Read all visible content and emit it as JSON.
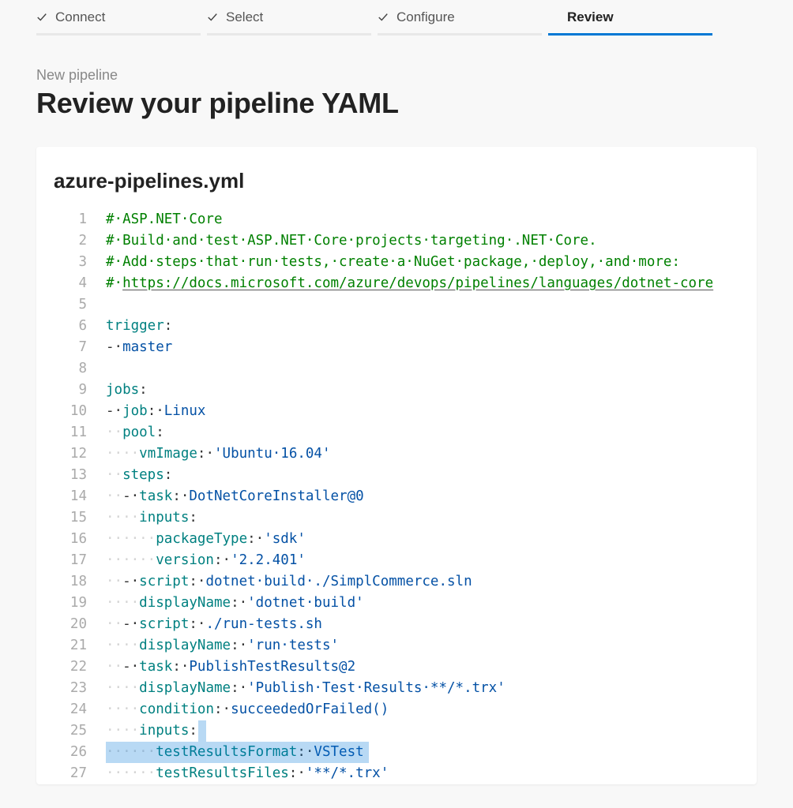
{
  "wizard": {
    "steps": [
      {
        "label": "Connect",
        "done": true,
        "active": false
      },
      {
        "label": "Select",
        "done": true,
        "active": false
      },
      {
        "label": "Configure",
        "done": true,
        "active": false
      },
      {
        "label": "Review",
        "done": false,
        "active": true
      }
    ]
  },
  "breadcrumb": "New pipeline",
  "title": "Review your pipeline YAML",
  "filename": "azure-pipelines.yml",
  "code": {
    "lines": [
      {
        "n": 1,
        "tokens": [
          [
            "comment",
            "# ASP.NET Core"
          ]
        ]
      },
      {
        "n": 2,
        "tokens": [
          [
            "comment",
            "# Build and test ASP.NET Core projects targeting .NET Core."
          ]
        ]
      },
      {
        "n": 3,
        "tokens": [
          [
            "comment",
            "# Add steps that run tests, create a NuGet package, deploy, and more:"
          ]
        ]
      },
      {
        "n": 4,
        "tokens": [
          [
            "comment",
            "# "
          ],
          [
            "link",
            "https://docs.microsoft.com/azure/devops/pipelines/languages/dotnet-core"
          ]
        ]
      },
      {
        "n": 5,
        "tokens": []
      },
      {
        "n": 6,
        "tokens": [
          [
            "key",
            "trigger"
          ],
          [
            "punct",
            ":"
          ]
        ]
      },
      {
        "n": 7,
        "tokens": [
          [
            "punct",
            "- "
          ],
          [
            "val",
            "master"
          ]
        ]
      },
      {
        "n": 8,
        "tokens": []
      },
      {
        "n": 9,
        "tokens": [
          [
            "key",
            "jobs"
          ],
          [
            "punct",
            ":"
          ]
        ]
      },
      {
        "n": 10,
        "tokens": [
          [
            "punct",
            "- "
          ],
          [
            "key",
            "job"
          ],
          [
            "punct",
            ": "
          ],
          [
            "val",
            "Linux"
          ]
        ]
      },
      {
        "n": 11,
        "tokens": [
          [
            "ws",
            "  "
          ],
          [
            "key",
            "pool"
          ],
          [
            "punct",
            ":"
          ]
        ]
      },
      {
        "n": 12,
        "tokens": [
          [
            "ws",
            "    "
          ],
          [
            "key",
            "vmImage"
          ],
          [
            "punct",
            ": "
          ],
          [
            "str",
            "'Ubuntu 16.04'"
          ]
        ]
      },
      {
        "n": 13,
        "tokens": [
          [
            "ws",
            "  "
          ],
          [
            "key",
            "steps"
          ],
          [
            "punct",
            ":"
          ]
        ]
      },
      {
        "n": 14,
        "tokens": [
          [
            "ws",
            "  "
          ],
          [
            "punct",
            "- "
          ],
          [
            "key",
            "task"
          ],
          [
            "punct",
            ": "
          ],
          [
            "val",
            "DotNetCoreInstaller@0"
          ]
        ]
      },
      {
        "n": 15,
        "tokens": [
          [
            "ws",
            "    "
          ],
          [
            "key",
            "inputs"
          ],
          [
            "punct",
            ":"
          ]
        ]
      },
      {
        "n": 16,
        "tokens": [
          [
            "ws",
            "      "
          ],
          [
            "key",
            "packageType"
          ],
          [
            "punct",
            ": "
          ],
          [
            "str",
            "'sdk'"
          ]
        ]
      },
      {
        "n": 17,
        "tokens": [
          [
            "ws",
            "      "
          ],
          [
            "key",
            "version"
          ],
          [
            "punct",
            ": "
          ],
          [
            "str",
            "'2.2.401'"
          ]
        ]
      },
      {
        "n": 18,
        "tokens": [
          [
            "ws",
            "  "
          ],
          [
            "punct",
            "- "
          ],
          [
            "key",
            "script"
          ],
          [
            "punct",
            ": "
          ],
          [
            "val",
            "dotnet build ./SimplCommerce.sln"
          ]
        ]
      },
      {
        "n": 19,
        "tokens": [
          [
            "ws",
            "    "
          ],
          [
            "key",
            "displayName"
          ],
          [
            "punct",
            ": "
          ],
          [
            "str",
            "'dotnet build'"
          ]
        ]
      },
      {
        "n": 20,
        "tokens": [
          [
            "ws",
            "  "
          ],
          [
            "punct",
            "- "
          ],
          [
            "key",
            "script"
          ],
          [
            "punct",
            ": "
          ],
          [
            "val",
            "./run-tests.sh"
          ]
        ]
      },
      {
        "n": 21,
        "tokens": [
          [
            "ws",
            "    "
          ],
          [
            "key",
            "displayName"
          ],
          [
            "punct",
            ": "
          ],
          [
            "str",
            "'run tests'"
          ]
        ]
      },
      {
        "n": 22,
        "tokens": [
          [
            "ws",
            "  "
          ],
          [
            "punct",
            "- "
          ],
          [
            "key",
            "task"
          ],
          [
            "punct",
            ": "
          ],
          [
            "val",
            "PublishTestResults@2"
          ]
        ]
      },
      {
        "n": 23,
        "tokens": [
          [
            "ws",
            "    "
          ],
          [
            "key",
            "displayName"
          ],
          [
            "punct",
            ": "
          ],
          [
            "str",
            "'Publish Test Results **/*.trx'"
          ]
        ]
      },
      {
        "n": 24,
        "tokens": [
          [
            "ws",
            "    "
          ],
          [
            "key",
            "condition"
          ],
          [
            "punct",
            ": "
          ],
          [
            "val",
            "succeededOrFailed()"
          ]
        ]
      },
      {
        "n": 25,
        "tokens": [
          [
            "ws",
            "    "
          ],
          [
            "key",
            "inputs"
          ],
          [
            "punct",
            ":"
          ]
        ],
        "cursorAfterCol": 11
      },
      {
        "n": 26,
        "tokens": [
          [
            "ws",
            "      "
          ],
          [
            "key",
            "testResultsFormat"
          ],
          [
            "punct",
            ": "
          ],
          [
            "val",
            "VSTest"
          ]
        ],
        "selected": true
      },
      {
        "n": 27,
        "tokens": [
          [
            "ws",
            "      "
          ],
          [
            "key",
            "testResultsFiles"
          ],
          [
            "punct",
            ": "
          ],
          [
            "str",
            "'**/*.trx'"
          ]
        ]
      }
    ]
  },
  "ws_glyph": "·"
}
